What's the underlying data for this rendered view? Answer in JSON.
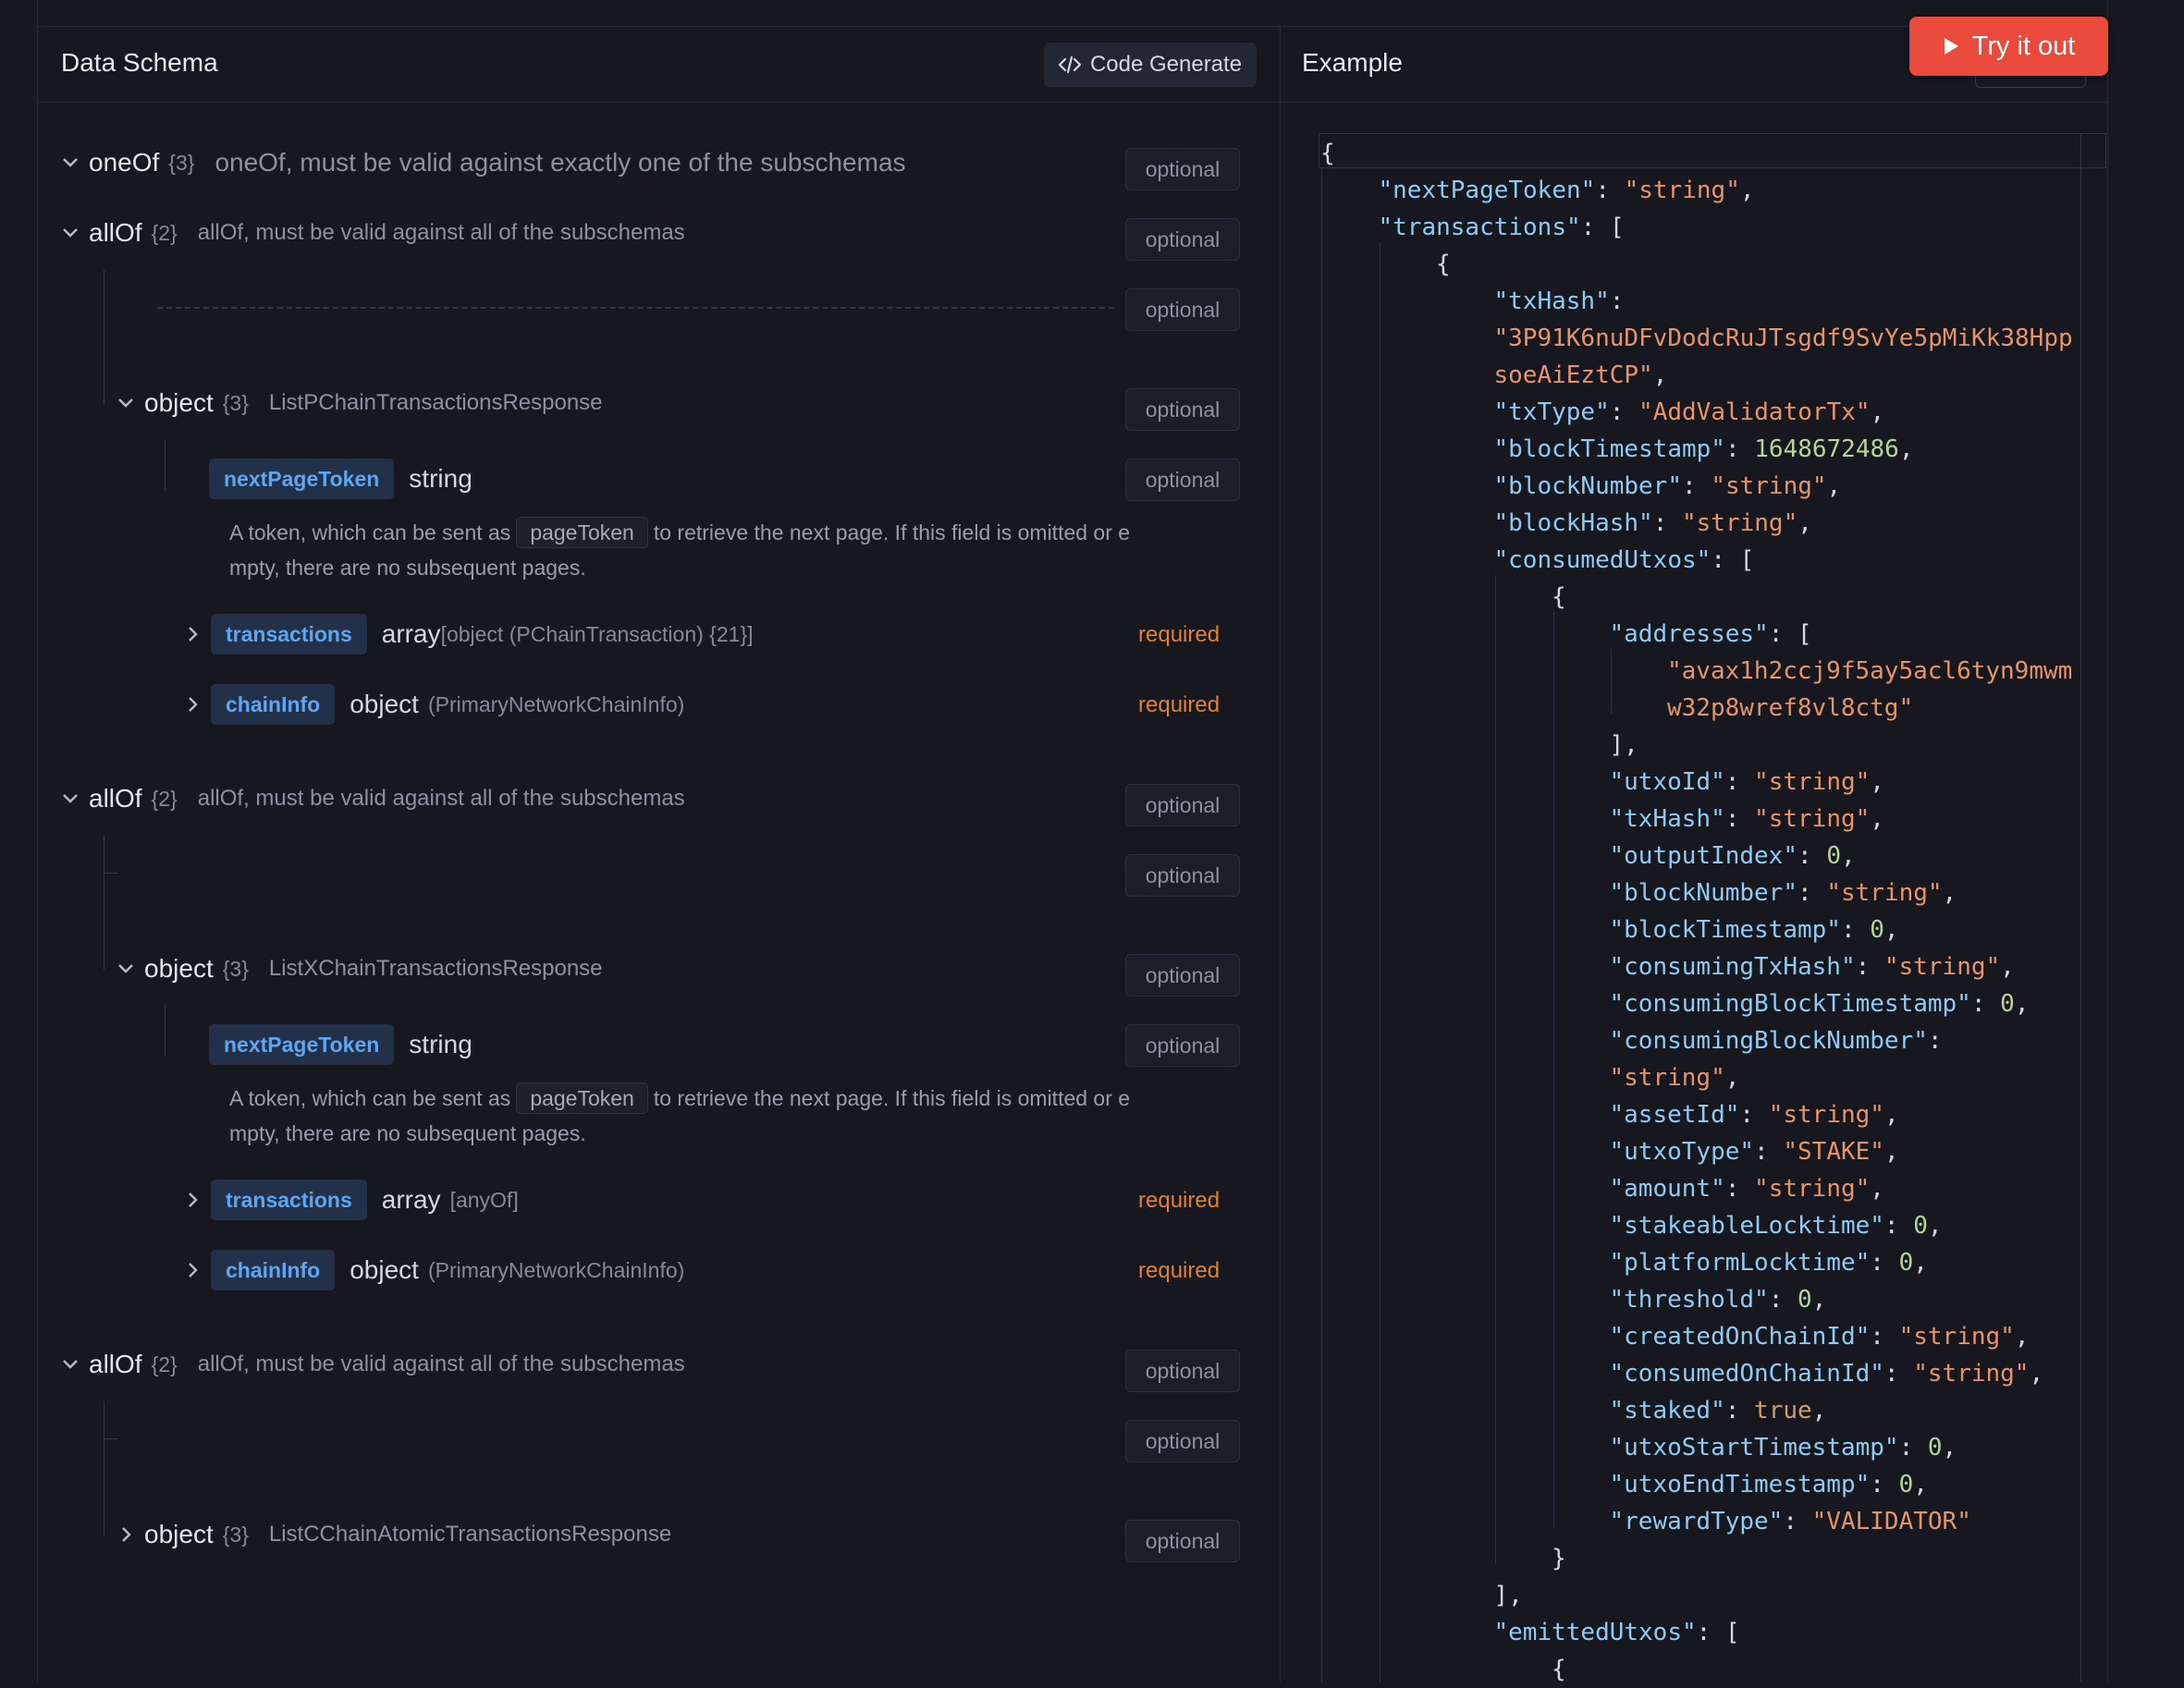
{
  "schema_panel": {
    "title": "Data Schema",
    "code_generate_label": "Code Generate",
    "optional": "optional",
    "required": "required",
    "oneof": {
      "kw": "oneOf",
      "count": "{3}",
      "desc": "oneOf, must be valid against exactly one of the subschemas"
    },
    "allof": {
      "kw": "allOf",
      "count": "{2}",
      "desc": "allOf, must be valid against all of the subschemas"
    },
    "object_kw": "object",
    "object_count": "{3}",
    "objects": [
      "ListPChainTransactionsResponse",
      "ListXChainTransactionsResponse",
      "ListCChainAtomicTransactionsResponse"
    ],
    "fields": {
      "next_page_token": "nextPageToken",
      "transactions": "transactions",
      "chain_info": "chainInfo",
      "string": "string",
      "array": "array",
      "object": "object",
      "p_tx_sub": "[object (PChainTransaction) {21}]",
      "any_of_sub": "[anyOf]",
      "chain_info_sub": "(PrimaryNetworkChainInfo)"
    },
    "token_note": {
      "before": "A token, which can be sent as",
      "code": "pageToken",
      "after": "to retrieve the next page. If this field is omitted or e",
      "line2": "mpty, there are no subsequent pages."
    }
  },
  "example_panel": {
    "title": "Example",
    "try_it_out_label": "Try it out",
    "json_lines": [
      [
        [
          0,
          "{",
          "p"
        ]
      ],
      [
        [
          1,
          "\"nextPageToken\"",
          "k"
        ],
        [
          1,
          ": ",
          "p"
        ],
        [
          1,
          "\"string\"",
          "s"
        ],
        [
          1,
          ",",
          "p"
        ]
      ],
      [
        [
          1,
          "\"transactions\"",
          "k"
        ],
        [
          1,
          ": [",
          "p"
        ]
      ],
      [
        [
          2,
          "{",
          "p"
        ]
      ],
      [
        [
          3,
          "\"txHash\"",
          "k"
        ],
        [
          3,
          ":",
          "p"
        ]
      ],
      [
        [
          3,
          "\"3P91K6nuDFvDodcRuJTsgdf9SvYe5pMiKk38Hpp",
          "s"
        ]
      ],
      [
        [
          3,
          "soeAiEztCP\"",
          "s"
        ],
        [
          3,
          ",",
          "p"
        ]
      ],
      [
        [
          3,
          "\"txType\"",
          "k"
        ],
        [
          3,
          ": ",
          "p"
        ],
        [
          3,
          "\"AddValidatorTx\"",
          "s"
        ],
        [
          3,
          ",",
          "p"
        ]
      ],
      [
        [
          3,
          "\"blockTimestamp\"",
          "k"
        ],
        [
          3,
          ": ",
          "p"
        ],
        [
          3,
          "1648672486",
          "n"
        ],
        [
          3,
          ",",
          "p"
        ]
      ],
      [
        [
          3,
          "\"blockNumber\"",
          "k"
        ],
        [
          3,
          ": ",
          "p"
        ],
        [
          3,
          "\"string\"",
          "s"
        ],
        [
          3,
          ",",
          "p"
        ]
      ],
      [
        [
          3,
          "\"blockHash\"",
          "k"
        ],
        [
          3,
          ": ",
          "p"
        ],
        [
          3,
          "\"string\"",
          "s"
        ],
        [
          3,
          ",",
          "p"
        ]
      ],
      [
        [
          3,
          "\"consumedUtxos\"",
          "k"
        ],
        [
          3,
          ": [",
          "p"
        ]
      ],
      [
        [
          4,
          "{",
          "p"
        ]
      ],
      [
        [
          5,
          "\"addresses\"",
          "k"
        ],
        [
          5,
          ": [",
          "p"
        ]
      ],
      [
        [
          6,
          "\"avax1h2ccj9f5ay5acl6tyn9mwm",
          "s"
        ]
      ],
      [
        [
          6,
          "w32p8wref8vl8ctg\"",
          "s"
        ]
      ],
      [
        [
          5,
          "],",
          "p"
        ]
      ],
      [
        [
          5,
          "\"utxoId\"",
          "k"
        ],
        [
          5,
          ": ",
          "p"
        ],
        [
          5,
          "\"string\"",
          "s"
        ],
        [
          5,
          ",",
          "p"
        ]
      ],
      [
        [
          5,
          "\"txHash\"",
          "k"
        ],
        [
          5,
          ": ",
          "p"
        ],
        [
          5,
          "\"string\"",
          "s"
        ],
        [
          5,
          ",",
          "p"
        ]
      ],
      [
        [
          5,
          "\"outputIndex\"",
          "k"
        ],
        [
          5,
          ": ",
          "p"
        ],
        [
          5,
          "0",
          "n"
        ],
        [
          5,
          ",",
          "p"
        ]
      ],
      [
        [
          5,
          "\"blockNumber\"",
          "k"
        ],
        [
          5,
          ": ",
          "p"
        ],
        [
          5,
          "\"string\"",
          "s"
        ],
        [
          5,
          ",",
          "p"
        ]
      ],
      [
        [
          5,
          "\"blockTimestamp\"",
          "k"
        ],
        [
          5,
          ": ",
          "p"
        ],
        [
          5,
          "0",
          "n"
        ],
        [
          5,
          ",",
          "p"
        ]
      ],
      [
        [
          5,
          "\"consumingTxHash\"",
          "k"
        ],
        [
          5,
          ": ",
          "p"
        ],
        [
          5,
          "\"string\"",
          "s"
        ],
        [
          5,
          ",",
          "p"
        ]
      ],
      [
        [
          5,
          "\"consumingBlockTimestamp\"",
          "k"
        ],
        [
          5,
          ": ",
          "p"
        ],
        [
          5,
          "0",
          "n"
        ],
        [
          5,
          ",",
          "p"
        ]
      ],
      [
        [
          5,
          "\"consumingBlockNumber\"",
          "k"
        ],
        [
          5,
          ":",
          "p"
        ]
      ],
      [
        [
          5,
          "\"string\"",
          "s"
        ],
        [
          5,
          ",",
          "p"
        ]
      ],
      [
        [
          5,
          "\"assetId\"",
          "k"
        ],
        [
          5,
          ": ",
          "p"
        ],
        [
          5,
          "\"string\"",
          "s"
        ],
        [
          5,
          ",",
          "p"
        ]
      ],
      [
        [
          5,
          "\"utxoType\"",
          "k"
        ],
        [
          5,
          ": ",
          "p"
        ],
        [
          5,
          "\"STAKE\"",
          "s"
        ],
        [
          5,
          ",",
          "p"
        ]
      ],
      [
        [
          5,
          "\"amount\"",
          "k"
        ],
        [
          5,
          ": ",
          "p"
        ],
        [
          5,
          "\"string\"",
          "s"
        ],
        [
          5,
          ",",
          "p"
        ]
      ],
      [
        [
          5,
          "\"stakeableLocktime\"",
          "k"
        ],
        [
          5,
          ": ",
          "p"
        ],
        [
          5,
          "0",
          "n"
        ],
        [
          5,
          ",",
          "p"
        ]
      ],
      [
        [
          5,
          "\"platformLocktime\"",
          "k"
        ],
        [
          5,
          ": ",
          "p"
        ],
        [
          5,
          "0",
          "n"
        ],
        [
          5,
          ",",
          "p"
        ]
      ],
      [
        [
          5,
          "\"threshold\"",
          "k"
        ],
        [
          5,
          ": ",
          "p"
        ],
        [
          5,
          "0",
          "n"
        ],
        [
          5,
          ",",
          "p"
        ]
      ],
      [
        [
          5,
          "\"createdOnChainId\"",
          "k"
        ],
        [
          5,
          ": ",
          "p"
        ],
        [
          5,
          "\"string\"",
          "s"
        ],
        [
          5,
          ",",
          "p"
        ]
      ],
      [
        [
          5,
          "\"consumedOnChainId\"",
          "k"
        ],
        [
          5,
          ": ",
          "p"
        ],
        [
          5,
          "\"string\"",
          "s"
        ],
        [
          5,
          ",",
          "p"
        ]
      ],
      [
        [
          5,
          "\"staked\"",
          "k"
        ],
        [
          5,
          ": ",
          "p"
        ],
        [
          5,
          "true",
          "b"
        ],
        [
          5,
          ",",
          "p"
        ]
      ],
      [
        [
          5,
          "\"utxoStartTimestamp\"",
          "k"
        ],
        [
          5,
          ": ",
          "p"
        ],
        [
          5,
          "0",
          "n"
        ],
        [
          5,
          ",",
          "p"
        ]
      ],
      [
        [
          5,
          "\"utxoEndTimestamp\"",
          "k"
        ],
        [
          5,
          ": ",
          "p"
        ],
        [
          5,
          "0",
          "n"
        ],
        [
          5,
          ",",
          "p"
        ]
      ],
      [
        [
          5,
          "\"rewardType\"",
          "k"
        ],
        [
          5,
          ": ",
          "p"
        ],
        [
          5,
          "\"VALIDATOR\"",
          "s"
        ]
      ],
      [
        [
          4,
          "}",
          "p"
        ]
      ],
      [
        [
          3,
          "],",
          "p"
        ]
      ],
      [
        [
          3,
          "\"emittedUtxos\"",
          "k"
        ],
        [
          3,
          ": [",
          "p"
        ]
      ],
      [
        [
          4,
          "{",
          "p"
        ]
      ]
    ]
  }
}
